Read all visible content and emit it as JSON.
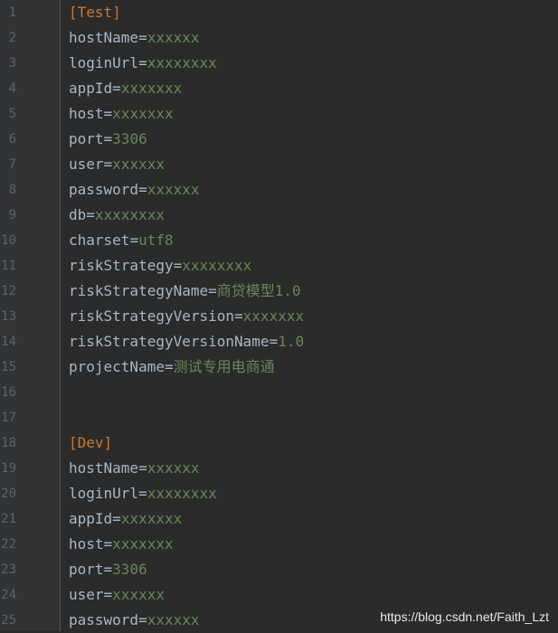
{
  "colors": {
    "background": "#2b2b2b",
    "gutter": "#313335",
    "line_number": "#606366",
    "section": "#cc7832",
    "key": "#a9b7c6",
    "value": "#6a8759"
  },
  "lines": [
    {
      "n": "1",
      "section": "[Test]"
    },
    {
      "n": "2",
      "key": "hostName",
      "eq": "=",
      "value": "xxxxxx"
    },
    {
      "n": "3",
      "key": "loginUrl",
      "eq": "=",
      "value": "xxxxxxxx"
    },
    {
      "n": "4",
      "key": "appId",
      "eq": "=",
      "value": "xxxxxxx"
    },
    {
      "n": "5",
      "key": "host",
      "eq": "=",
      "value": "xxxxxxx"
    },
    {
      "n": "6",
      "key": "port",
      "eq": "=",
      "value": "3306"
    },
    {
      "n": "7",
      "key": "user",
      "eq": "=",
      "value": "xxxxxx"
    },
    {
      "n": "8",
      "key": "password",
      "eq": "=",
      "value": "xxxxxx"
    },
    {
      "n": "9",
      "key": "db",
      "eq": "=",
      "value": "xxxxxxxx"
    },
    {
      "n": "10",
      "key": "charset",
      "eq": "=",
      "value": "utf8"
    },
    {
      "n": "11",
      "key": "riskStrategy",
      "eq": "=",
      "value": "xxxxxxxx"
    },
    {
      "n": "12",
      "key": "riskStrategyName",
      "eq": "=",
      "value": "商贷模型1.0"
    },
    {
      "n": "13",
      "key": "riskStrategyVersion",
      "eq": "=",
      "value": "xxxxxxx"
    },
    {
      "n": "14",
      "key": "riskStrategyVersionName",
      "eq": "=",
      "value": "1.0"
    },
    {
      "n": "15",
      "key": "projectName",
      "eq": "=",
      "value": "测试专用电商通"
    },
    {
      "n": "16"
    },
    {
      "n": "17"
    },
    {
      "n": "18",
      "section": "[Dev]"
    },
    {
      "n": "19",
      "key": "hostName",
      "eq": "=",
      "value": "xxxxxx"
    },
    {
      "n": "20",
      "key": "loginUrl",
      "eq": "=",
      "value": "xxxxxxxx"
    },
    {
      "n": "21",
      "key": "appId",
      "eq": "=",
      "value": "xxxxxxx"
    },
    {
      "n": "22",
      "key": "host",
      "eq": "=",
      "value": "xxxxxxx"
    },
    {
      "n": "23",
      "key": "port",
      "eq": "=",
      "value": "3306"
    },
    {
      "n": "24",
      "key": "user",
      "eq": "=",
      "value": "xxxxxx"
    },
    {
      "n": "25",
      "key": "password",
      "eq": "=",
      "value": "xxxxxx"
    }
  ],
  "watermark": "https://blog.csdn.net/Faith_Lzt"
}
